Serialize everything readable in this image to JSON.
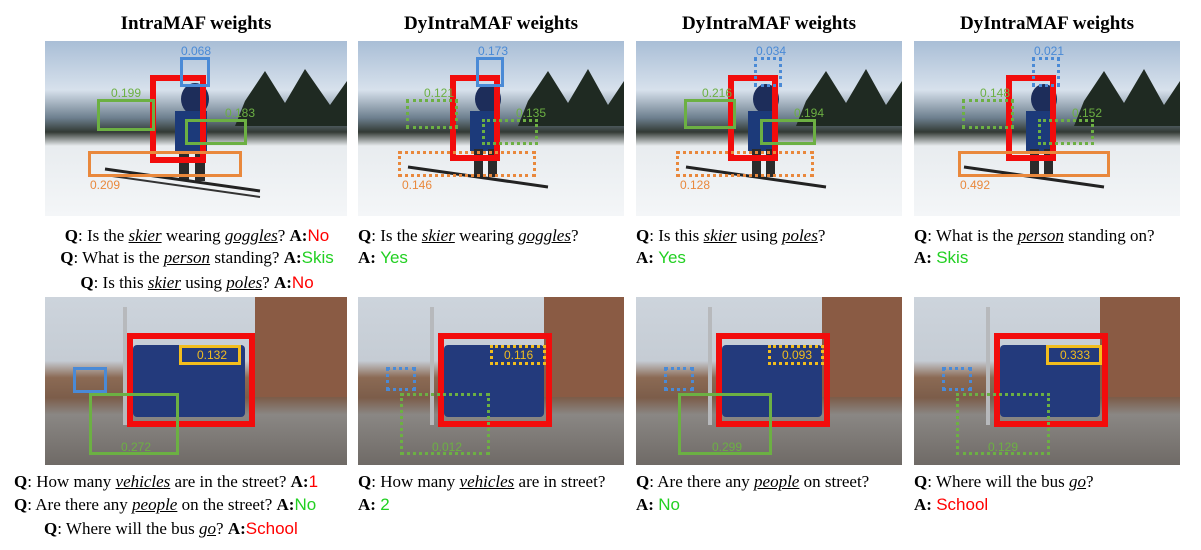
{
  "columns": [
    {
      "title": "IntraMAF weights"
    },
    {
      "title": "DyIntraMAF weights"
    },
    {
      "title": "DyIntraMAF weights"
    },
    {
      "title": "DyIntraMAF weights"
    }
  ],
  "row1": {
    "weights": [
      {
        "blue": "0.068",
        "green_left": "0.199",
        "green_right": "0.183",
        "orange": "0.209"
      },
      {
        "blue": "0.173",
        "green_left": "0.121",
        "green_right": "0.135",
        "orange": "0.146"
      },
      {
        "blue": "0.034",
        "green_left": "0.216",
        "green_right": "0.194",
        "orange": "0.128"
      },
      {
        "blue": "0.021",
        "green_left": "0.148",
        "green_right": "0.152",
        "orange": "0.492"
      }
    ],
    "qa_col1": [
      {
        "q_pre": ": Is the ",
        "k1": "skier",
        "q_mid": " wearing ",
        "k2": "goggles",
        "q_post": "? ",
        "a_label": "A:",
        "answer": "No"
      },
      {
        "q_pre": ": What is the ",
        "k1": "person",
        "q_mid": " standing? ",
        "k2": "",
        "q_post": "",
        "a_label": "A:",
        "answer": "Skis"
      },
      {
        "q_pre": ": Is this ",
        "k1": "skier",
        "q_mid": " using ",
        "k2": "poles",
        "q_post": "? ",
        "a_label": "A:",
        "answer": "No"
      }
    ],
    "qa_col2": {
      "q_pre": ": Is the ",
      "k1": "skier",
      "q_mid": " wearing ",
      "k2": "goggles",
      "q_post": "?",
      "a_label": "A",
      "answer": "Yes"
    },
    "qa_col3": {
      "q_pre": ": Is this ",
      "k1": "skier",
      "q_mid": " using ",
      "k2": "poles",
      "q_post": "?",
      "a_label": "A",
      "answer": "Yes"
    },
    "qa_col4": {
      "q_pre": ": What is the ",
      "k1": "person",
      "q_mid": " standing on?",
      "a_label": "A",
      "answer": "Skis"
    }
  },
  "row2": {
    "weights": [
      {
        "yellow": "0.132",
        "green": "0.272"
      },
      {
        "yellow": "0.116",
        "green": "0.012"
      },
      {
        "yellow": "0.093",
        "green": "0.299"
      },
      {
        "yellow": "0.333",
        "green": "0.129"
      }
    ],
    "qa_col1": [
      {
        "q_pre": ": How many ",
        "k1": "vehicles",
        "q_post": " are in the street? ",
        "a_label": "A:",
        "answer": "1"
      },
      {
        "q_pre": ": Are there any ",
        "k1": "people",
        "q_post": " on the street? ",
        "a_label": "A:",
        "answer": "No"
      },
      {
        "q_pre": ": Where will the bus ",
        "k1": "go",
        "q_post": "? ",
        "a_label": "A:",
        "answer": "School"
      }
    ],
    "qa_col2": {
      "q_pre": ": How many ",
      "k1": "vehicles",
      "q_post": " are in street?",
      "a_label": "A",
      "answer": "2"
    },
    "qa_col3": {
      "q_pre": ": Are there any ",
      "k1": "people",
      "q_post": " on street?",
      "a_label": "A",
      "answer": "No"
    },
    "qa_col4": {
      "q_pre": ": Where will the bus ",
      "k1": "go",
      "q_post": "?",
      "a_label": "A",
      "answer": "School"
    }
  },
  "labels": {
    "q": "Q",
    "colon": ":"
  },
  "colors": {
    "red_box": "#f20c0c",
    "blue": "#4a8ad6",
    "green": "#6cb043",
    "orange": "#e9883c",
    "yellow": "#f2bd1e",
    "answer_red": "#ff0000",
    "answer_green": "#22d022"
  }
}
